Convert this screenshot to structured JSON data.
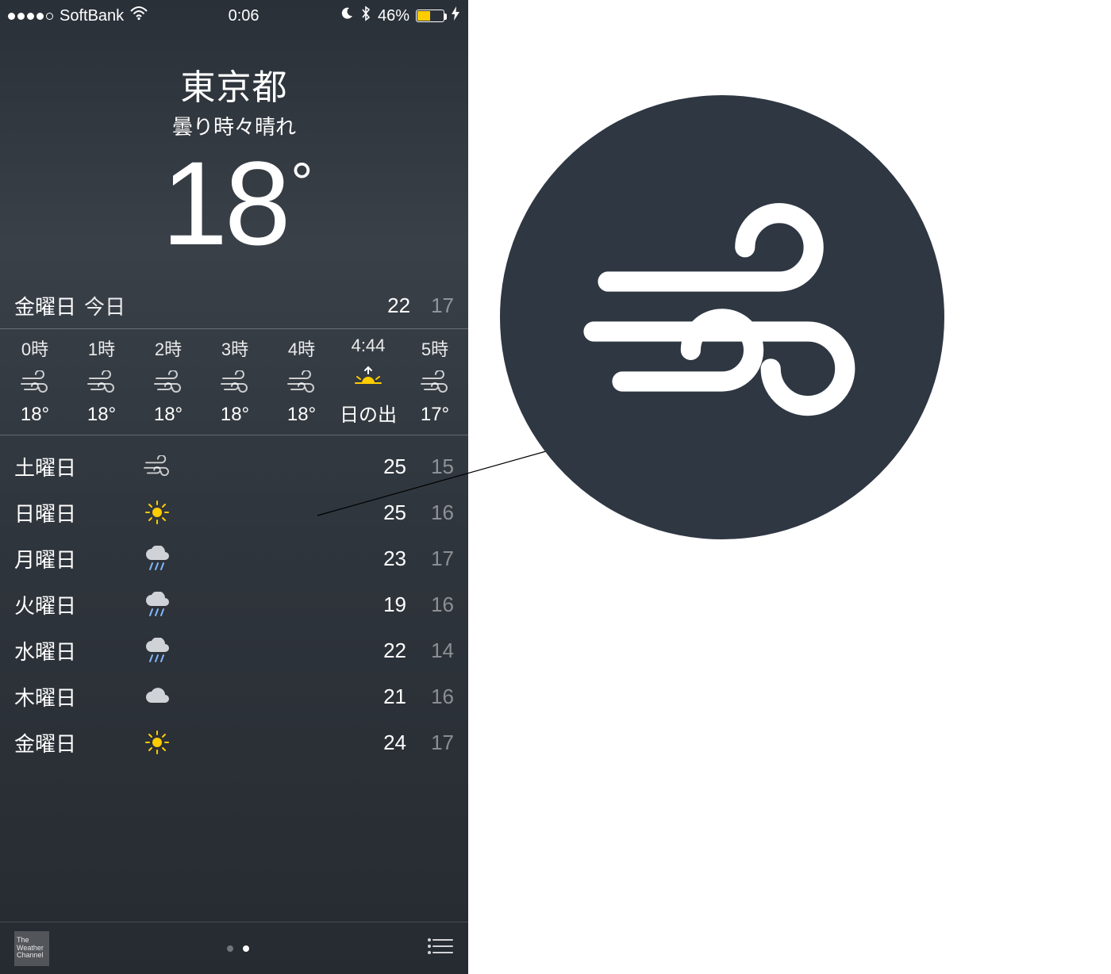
{
  "status_bar": {
    "carrier": "SoftBank",
    "time": "0:06",
    "battery_percent": "46%"
  },
  "hero": {
    "city": "東京都",
    "condition": "曇り時々晴れ",
    "temp": "18",
    "degree": "°"
  },
  "today": {
    "dayname": "金曜日",
    "label": "今日",
    "hi": "22",
    "lo": "17"
  },
  "hourly": [
    {
      "label": "0時",
      "icon": "wind",
      "temp": "18°"
    },
    {
      "label": "1時",
      "icon": "wind",
      "temp": "18°"
    },
    {
      "label": "2時",
      "icon": "wind",
      "temp": "18°"
    },
    {
      "label": "3時",
      "icon": "wind",
      "temp": "18°"
    },
    {
      "label": "4時",
      "icon": "wind",
      "temp": "18°"
    },
    {
      "label": "4:44",
      "icon": "sunrise",
      "temp": "日の出"
    },
    {
      "label": "5時",
      "icon": "wind",
      "temp": "17°"
    }
  ],
  "daily": [
    {
      "day": "土曜日",
      "icon": "wind",
      "hi": "25",
      "lo": "15"
    },
    {
      "day": "日曜日",
      "icon": "sun",
      "hi": "25",
      "lo": "16"
    },
    {
      "day": "月曜日",
      "icon": "rain",
      "hi": "23",
      "lo": "17"
    },
    {
      "day": "火曜日",
      "icon": "rain",
      "hi": "19",
      "lo": "16"
    },
    {
      "day": "水曜日",
      "icon": "rain",
      "hi": "22",
      "lo": "14"
    },
    {
      "day": "木曜日",
      "icon": "cloud",
      "hi": "21",
      "lo": "16"
    },
    {
      "day": "金曜日",
      "icon": "sun",
      "hi": "24",
      "lo": "17"
    }
  ],
  "footer": {
    "attribution_l1": "The",
    "attribution_l2": "Weather",
    "attribution_l3": "Channel"
  },
  "callout": {
    "icon": "wind"
  }
}
